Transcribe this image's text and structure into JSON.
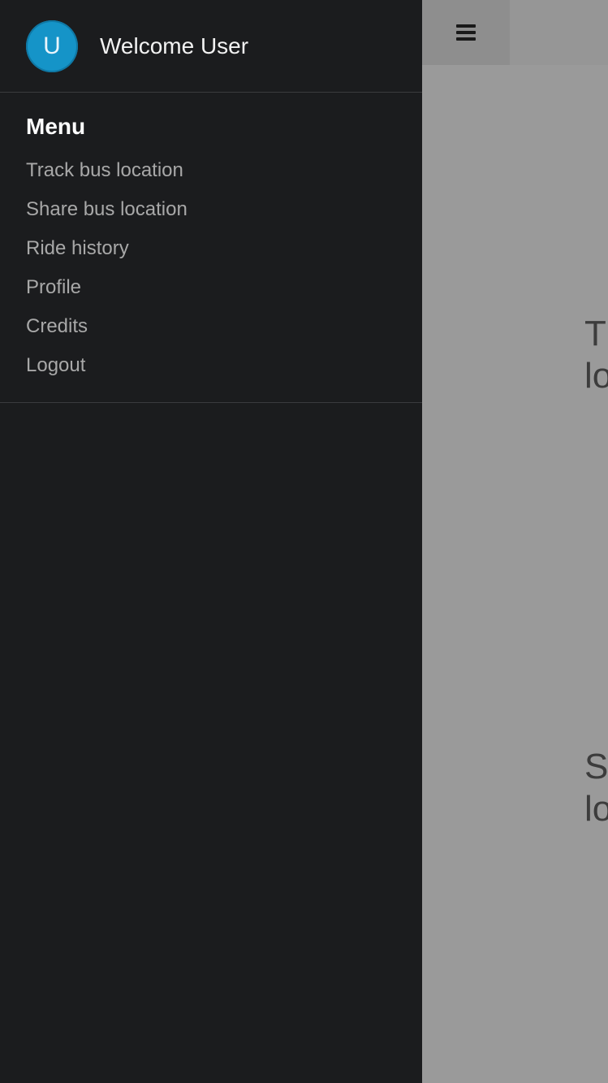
{
  "drawer": {
    "avatar_letter": "U",
    "welcome_text": "Welcome User",
    "menu_title": "Menu",
    "items": [
      {
        "label": "Track bus location"
      },
      {
        "label": "Share bus location"
      },
      {
        "label": "Ride history"
      },
      {
        "label": "Profile"
      },
      {
        "label": "Credits"
      },
      {
        "label": "Logout"
      }
    ]
  },
  "main": {
    "menu_toggle_icon": "hamburger-icon",
    "options": [
      {
        "line1": "T",
        "line2": "lo"
      },
      {
        "line1": "S",
        "line2": "lo"
      }
    ]
  },
  "colors": {
    "drawer_bg": "#1b1c1e",
    "avatar_bg": "#1594c8",
    "overlay_bg": "#9a9a9a",
    "menu_item_text": "#a8a8a8"
  }
}
